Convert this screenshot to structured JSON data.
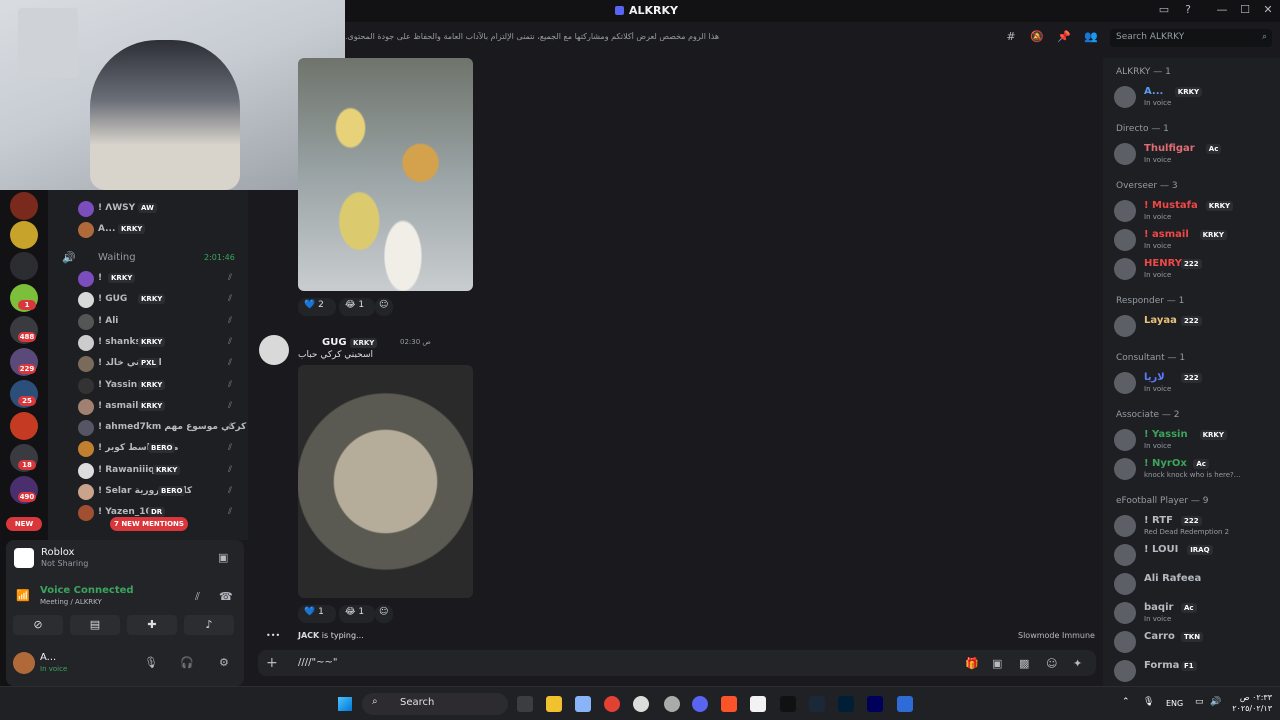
{
  "app": {
    "title": "ALKRKY",
    "topic": "هذا الروم مخصص لعرض أكلاتكم ومشاركتها مع الجميع، نتمنى الإلتزام بالآداب العامة والحفاظ على جودة المحتوى.",
    "search_placeholder": "Search ALKRKY"
  },
  "voice_channel": {
    "top_members": [
      {
        "name": "! ΛWSY",
        "tag": "AW"
      },
      {
        "name": "A...",
        "tag": "KRKY"
      }
    ],
    "channel_name": "Waiting",
    "timer": "2:01:46",
    "members": [
      {
        "name": "!",
        "tag": "KRKY"
      },
      {
        "name": "! GUG",
        "tag": "KRKY"
      },
      {
        "name": "! Ali",
        "tag": ""
      },
      {
        "name": "! shanks",
        "tag": "KRKY"
      },
      {
        "name": "! اسحبني خالد",
        "tag": "PXL"
      },
      {
        "name": "! Yassin",
        "tag": "KRKY"
      },
      {
        "name": "! asmail",
        "tag": "KRKY"
      },
      {
        "name": "! ahmed7km كركي موسوع مهم",
        "tag": ""
      },
      {
        "name": "! ملكة واسط كوبر",
        "tag": "BERO"
      },
      {
        "name": "! Rawaniiiq",
        "tag": "KRKY"
      },
      {
        "name": "! Selar كلمة سرورية",
        "tag": "BERO"
      },
      {
        "name": "! Yazen_103",
        "tag": "DR"
      }
    ],
    "new_mentions": "7 NEW MENTIONS",
    "new_badge": "NEW"
  },
  "server_badges": [
    "1",
    "488",
    "229",
    "25",
    "18",
    "490"
  ],
  "activity": {
    "app": "Roblox",
    "status": "Not Sharing"
  },
  "voice_status": {
    "label": "Voice Connected",
    "channel": "Meeting / ALKRKY"
  },
  "user": {
    "name": "A...",
    "status": "In voice"
  },
  "messages": [
    {
      "reactions": [
        {
          "emoji": "💙",
          "count": "2"
        },
        {
          "emoji": "😂",
          "count": "1"
        }
      ]
    },
    {
      "author": "GUG",
      "tag": "KRKY",
      "time": "02:30 ص",
      "text": "اسحبني كركي حباب",
      "reactions": [
        {
          "emoji": "💙",
          "count": "1"
        },
        {
          "emoji": "😂",
          "count": "1"
        }
      ]
    }
  ],
  "typing": {
    "name": "JACK",
    "suffix": " is typing..."
  },
  "slowmode": "Slowmode Immune",
  "composer_text": "////\"~~\"",
  "member_list": [
    {
      "role": "ALKRKY — 1",
      "members": [
        {
          "name": "A...",
          "tag": "KRKY",
          "status": "In voice",
          "color": "#5b9cf0"
        }
      ]
    },
    {
      "role": "Directo — 1",
      "members": [
        {
          "name": "Thulfigar",
          "tag": "Ac",
          "status": "In voice",
          "color": "#e06c75"
        }
      ]
    },
    {
      "role": "Overseer — 3",
      "members": [
        {
          "name": "! Mustafa",
          "tag": "KRKY",
          "status": "In voice",
          "color": "#f04747"
        },
        {
          "name": "! asmail",
          "tag": "KRKY",
          "status": "In voice",
          "color": "#f04747"
        },
        {
          "name": "HENRY",
          "tag": "222",
          "status": "In voice",
          "color": "#f04747"
        }
      ]
    },
    {
      "role": "Responder — 1",
      "members": [
        {
          "name": "Layaa",
          "tag": "222",
          "status": "",
          "color": "#e8c27a"
        }
      ]
    },
    {
      "role": "Consultant — 1",
      "members": [
        {
          "name": "لاريا",
          "tag": "222",
          "status": "In voice",
          "color": "#5b7cff"
        }
      ]
    },
    {
      "role": "Associate — 2",
      "members": [
        {
          "name": "! Yassin",
          "tag": "KRKY",
          "status": "In voice",
          "color": "#3ba55d"
        },
        {
          "name": "! NyrOx",
          "tag": "Ac",
          "status": "knock knock who is here?...",
          "color": "#3ba55d"
        }
      ]
    },
    {
      "role": "eFootball Player — 9",
      "members": [
        {
          "name": "! RTF",
          "tag": "222",
          "status": "Red Dead Redemption 2",
          "color": "#b5bac1"
        },
        {
          "name": "! LOUI",
          "tag": "IRAQ",
          "status": "",
          "color": "#b5bac1"
        },
        {
          "name": "Ali Rafeea",
          "tag": "",
          "status": "",
          "color": "#b5bac1"
        },
        {
          "name": "baqir",
          "tag": "Ac",
          "status": "In voice",
          "color": "#b5bac1"
        },
        {
          "name": "Carro",
          "tag": "TKN",
          "status": "",
          "color": "#b5bac1"
        },
        {
          "name": "Forma",
          "tag": "F1",
          "status": "",
          "color": "#b5bac1"
        }
      ]
    }
  ],
  "taskbar": {
    "search": "Search",
    "lang": "ENG",
    "time": "٠٢:٣٣ ص",
    "date": "٢٠٢٥/٠٢/١٣"
  }
}
